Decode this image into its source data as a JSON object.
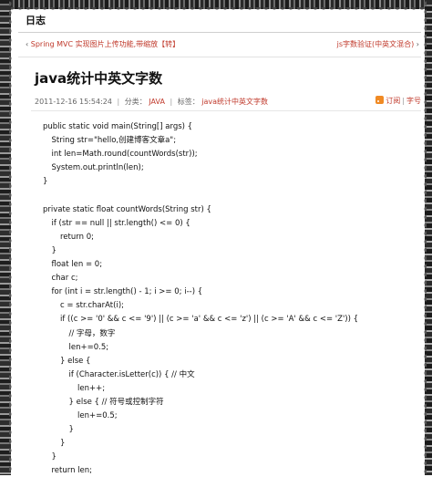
{
  "header": {
    "title": "日志"
  },
  "nav": {
    "prev_arrow": "‹",
    "prev_label": "Spring MVC 实现图片上传功能,带缩放【转】",
    "next_label": "js字数验证(中英文混合)",
    "next_arrow": "›"
  },
  "post": {
    "title": "java统计中英文字数",
    "date": "2011-12-16 15:54:24",
    "category_label": "分类：",
    "category": "JAVA",
    "tags_label": "标签：",
    "tags": "java统计中英文字数",
    "subscribe": "订阅",
    "font_size": "字号"
  },
  "code_lines": [
    "public static void main(String[] args) {",
    "String str=\"hello,创建博客文章a\";",
    "int len=Math.round(countWords(str));",
    "System.out.println(len);",
    "}",
    "",
    "private static float countWords(String str) {",
    "if (str == null || str.length() <= 0) {",
    "return 0;",
    "}",
    "float len = 0;",
    "char c;",
    "for (int i = str.length() - 1; i >= 0; i--) {",
    "c = str.charAt(i);",
    "if ((c >= '0' && c <= '9') || (c >= 'a' && c <= 'z') || (c >= 'A' && c <= 'Z')) {",
    "// 字母，数字",
    "len+=0.5;",
    "} else {",
    "if (Character.isLetter(c)) { // 中文",
    "len++;",
    "} else { // 符号或控制字符",
    "len+=0.5;",
    "}",
    "}",
    "}",
    "return len;"
  ]
}
